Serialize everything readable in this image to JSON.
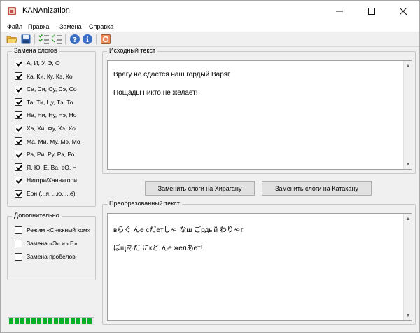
{
  "window": {
    "title": "KANAnization"
  },
  "menu": [
    "Файл",
    "Правка",
    "Замена",
    "Справка"
  ],
  "toolbar": {
    "icons": [
      "open-folder-icon",
      "save-disk-icon",
      "check-all-icon",
      "uncheck-all-icon",
      "help-icon",
      "info-icon",
      "exit-icon"
    ]
  },
  "syllables": {
    "title": "Замена слогов",
    "items": [
      {
        "label": "А, И, У, Э, О",
        "checked": true
      },
      {
        "label": "Ка, Ки, Ку, Кэ, Ко",
        "checked": true
      },
      {
        "label": "Са, Си, Су, Сэ, Со",
        "checked": true
      },
      {
        "label": "Та, Ти, Цу, Тэ, То",
        "checked": true
      },
      {
        "label": "На, Ни, Ну, Нэ, Но",
        "checked": true
      },
      {
        "label": "Ха, Хи, Фу, Хэ, Хо",
        "checked": true
      },
      {
        "label": "Ма, Ми, Му, Мэ, Мо",
        "checked": true
      },
      {
        "label": "Ра, Ри, Ру, Рэ, Ро",
        "checked": true
      },
      {
        "label": "Я, Ю, Ё, Ва, вО, Н",
        "checked": true
      },
      {
        "label": "Нигори/Ханнигори",
        "checked": true
      },
      {
        "label": "Ёон (...я, ...ю, ...ё)",
        "checked": true
      }
    ]
  },
  "extra": {
    "title": "Дополнительно",
    "items": [
      {
        "label": "Режим «Снежный ком»",
        "checked": false
      },
      {
        "label": "Замена «Э» и «Е»",
        "checked": false
      },
      {
        "label": "Замена пробелов",
        "checked": false
      }
    ]
  },
  "source": {
    "title": "Исходный текст",
    "lines": [
      "Врагу не сдается наш гордый Варяг",
      "Пощады никто не желает!"
    ]
  },
  "buttons": {
    "hiragana": "Заменить слоги на Хирагану",
    "katakana": "Заменить слоги на Катакану"
  },
  "result": {
    "title": "Преобразованный текст",
    "lines": [
      "вらぐ んe cだeтしゃ なш ごрдый わりゃг",
      "ぽщあだ にкと んe жeлあeт!"
    ]
  },
  "progress": {
    "value": 1.0
  }
}
